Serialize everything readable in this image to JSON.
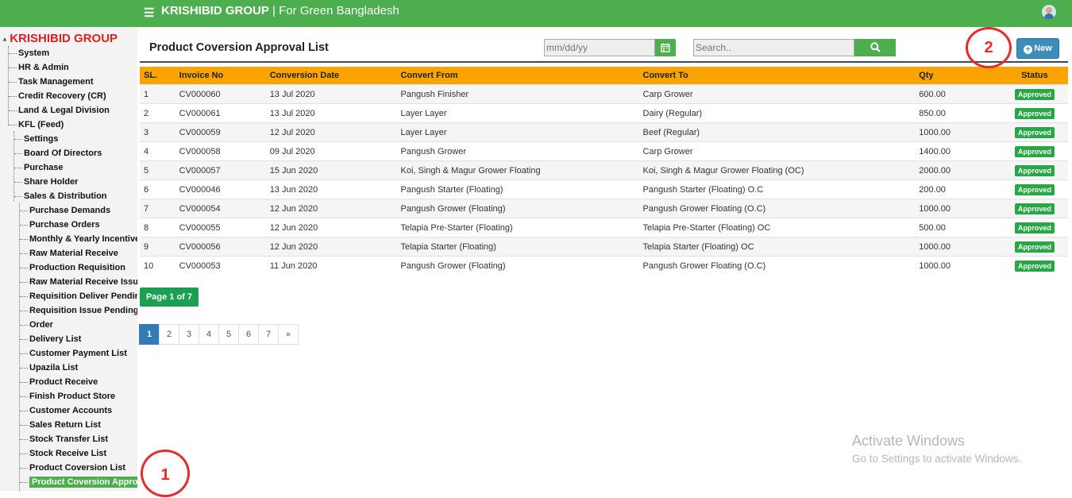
{
  "topbar": {
    "menu_icon": "hamburger-icon",
    "brand_bold": "KRISHIBID GROUP",
    "brand_sep": " | ",
    "brand_tagline": "For Green Bangladesh",
    "avatar_icon": "user-avatar-icon"
  },
  "sidebar": {
    "root": "KRISHIBID GROUP",
    "top_items": [
      "System",
      "HR & Admin",
      "Task Management",
      "Credit Recovery (CR)",
      "Land & Legal Division",
      "KFL (Feed)"
    ],
    "kfl_items": [
      "Settings",
      "Board Of Directors",
      "Purchase",
      "Share Holder",
      "Sales & Distribution"
    ],
    "sd_items": [
      "Purchase Demands",
      "Purchase Orders",
      "Monthly & Yearly Incentive",
      "Raw Material Receive",
      "Production Requisition",
      "Raw Material Receive Issue",
      "Requisition Deliver Pending",
      "Requisition Issue Pending",
      "Order",
      "Delivery List",
      "Customer Payment List",
      "Upazila List",
      "Product Receive",
      "Finish Product Store",
      "Customer Accounts",
      "Sales Return List",
      "Stock Transfer List",
      "Stock Receive List",
      "Product Coversion List",
      "Product Coversion Approva"
    ]
  },
  "page": {
    "title": "Product Coversion Approval List",
    "date_placeholder": "mm/dd/yy",
    "search_placeholder": "Search..",
    "new_label": "New",
    "calendar_icon": "calendar-icon",
    "search_icon": "search-icon",
    "plus_icon": "plus-circle-icon"
  },
  "table": {
    "headers": [
      "SL.",
      "Invoice No",
      "Conversion Date",
      "Convert From",
      "Convert To",
      "Qty",
      "Status"
    ],
    "rows": [
      [
        "1",
        "CV000060",
        "13 Jul 2020",
        "Pangush Finisher",
        "Carp Grower",
        "600.00",
        "Approved"
      ],
      [
        "2",
        "CV000061",
        "13 Jul 2020",
        "Layer Layer",
        "Dairy (Regular)",
        "850.00",
        "Approved"
      ],
      [
        "3",
        "CV000059",
        "12 Jul 2020",
        "Layer Layer",
        "Beef (Regular)",
        "1000.00",
        "Approved"
      ],
      [
        "4",
        "CV000058",
        "09 Jul 2020",
        "Pangush Grower",
        "Carp Grower",
        "1400.00",
        "Approved"
      ],
      [
        "5",
        "CV000057",
        "15 Jun 2020",
        "Koi, Singh & Magur Grower Floating",
        "Koi, Singh & Magur Grower Floating (OC)",
        "2000.00",
        "Approved"
      ],
      [
        "6",
        "CV000046",
        "13 Jun 2020",
        "Pangush Starter (Floating)",
        "Pangush Starter (Floating) O.C",
        "200.00",
        "Approved"
      ],
      [
        "7",
        "CV000054",
        "12 Jun 2020",
        "Pangush Grower (Floating)",
        "Pangush Grower Floating (O.C)",
        "1000.00",
        "Approved"
      ],
      [
        "8",
        "CV000055",
        "12 Jun 2020",
        "Telapia Pre-Starter (Floating)",
        "Telapia Pre-Starter (Floating) OC",
        "500.00",
        "Approved"
      ],
      [
        "9",
        "CV000056",
        "12 Jun 2020",
        "Telapia Starter (Floating)",
        "Telapia Starter (Floating) OC",
        "1000.00",
        "Approved"
      ],
      [
        "10",
        "CV000053",
        "11 Jun 2020",
        "Pangush Grower (Floating)",
        "Pangush Grower Floating (O.C)",
        "1000.00",
        "Approved"
      ]
    ]
  },
  "pagination": {
    "info": "Page 1 of 7",
    "pages": [
      "1",
      "2",
      "3",
      "4",
      "5",
      "6",
      "7",
      "»"
    ]
  },
  "annotations": [
    "1",
    "2"
  ],
  "watermark": {
    "line1": "Activate Windows",
    "line2": "Go to Settings to activate Windows."
  },
  "colors": {
    "topbar": "#4cae4c",
    "table_header": "#f9a400",
    "approved": "#28a745",
    "new_button": "#3c8dbc",
    "annotation": "#e52b2b"
  }
}
